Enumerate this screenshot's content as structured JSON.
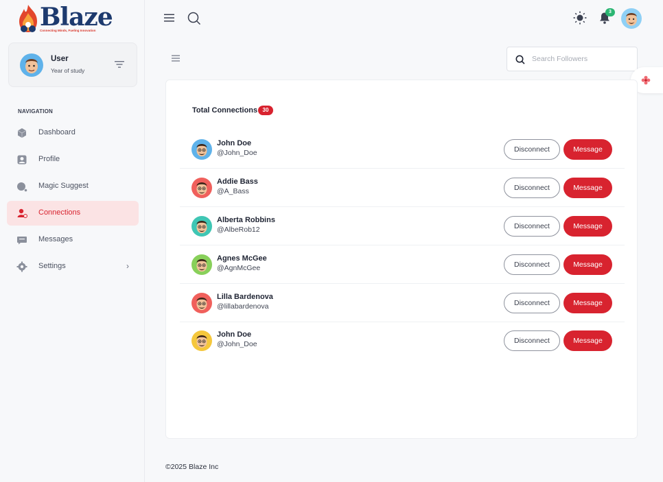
{
  "brand": {
    "name": "Blaze",
    "tagline": "Connecting Minds, Fueling Innovation",
    "accent": "#d8232f",
    "brand_color": "#1d3a6e"
  },
  "user": {
    "name": "User",
    "subtitle": "Year of study",
    "icon": "filter-icon"
  },
  "sidebar": {
    "heading": "NAVIGATION",
    "items": [
      {
        "label": "Dashboard",
        "icon": "cube-icon",
        "active": false
      },
      {
        "label": "Profile",
        "icon": "user-icon",
        "active": false
      },
      {
        "label": "Magic Suggest",
        "icon": "magic-icon",
        "active": false
      },
      {
        "label": "Connections",
        "icon": "connections-icon",
        "active": true
      },
      {
        "label": "Messages",
        "icon": "message-icon",
        "active": false
      },
      {
        "label": "Settings",
        "icon": "gear-icon",
        "active": false,
        "chevron": "›"
      }
    ]
  },
  "topbar": {
    "notification_count": "3"
  },
  "search": {
    "placeholder": "Search Followers",
    "value": ""
  },
  "connections": {
    "title": "Total Connections",
    "count": "30",
    "disconnect_label": "Disconnect",
    "message_label": "Message",
    "list": [
      {
        "name": "John Doe",
        "handle": "@John_Doe",
        "avatar_bg": "#5fb2ea"
      },
      {
        "name": "Addie Bass",
        "handle": "@A_Bass",
        "avatar_bg": "#f0605c"
      },
      {
        "name": "Alberta Robbins",
        "handle": "@AlbeRob12",
        "avatar_bg": "#3fc6b4"
      },
      {
        "name": "Agnes McGee",
        "handle": "@AgnMcGee",
        "avatar_bg": "#88d05a"
      },
      {
        "name": "Lilla Bardenova",
        "handle": "@lillabardenova",
        "avatar_bg": "#f0605c"
      },
      {
        "name": "John Doe",
        "handle": "@John_Doe",
        "avatar_bg": "#f5c73c"
      }
    ]
  },
  "footer": {
    "text": "©2025 Blaze Inc"
  }
}
